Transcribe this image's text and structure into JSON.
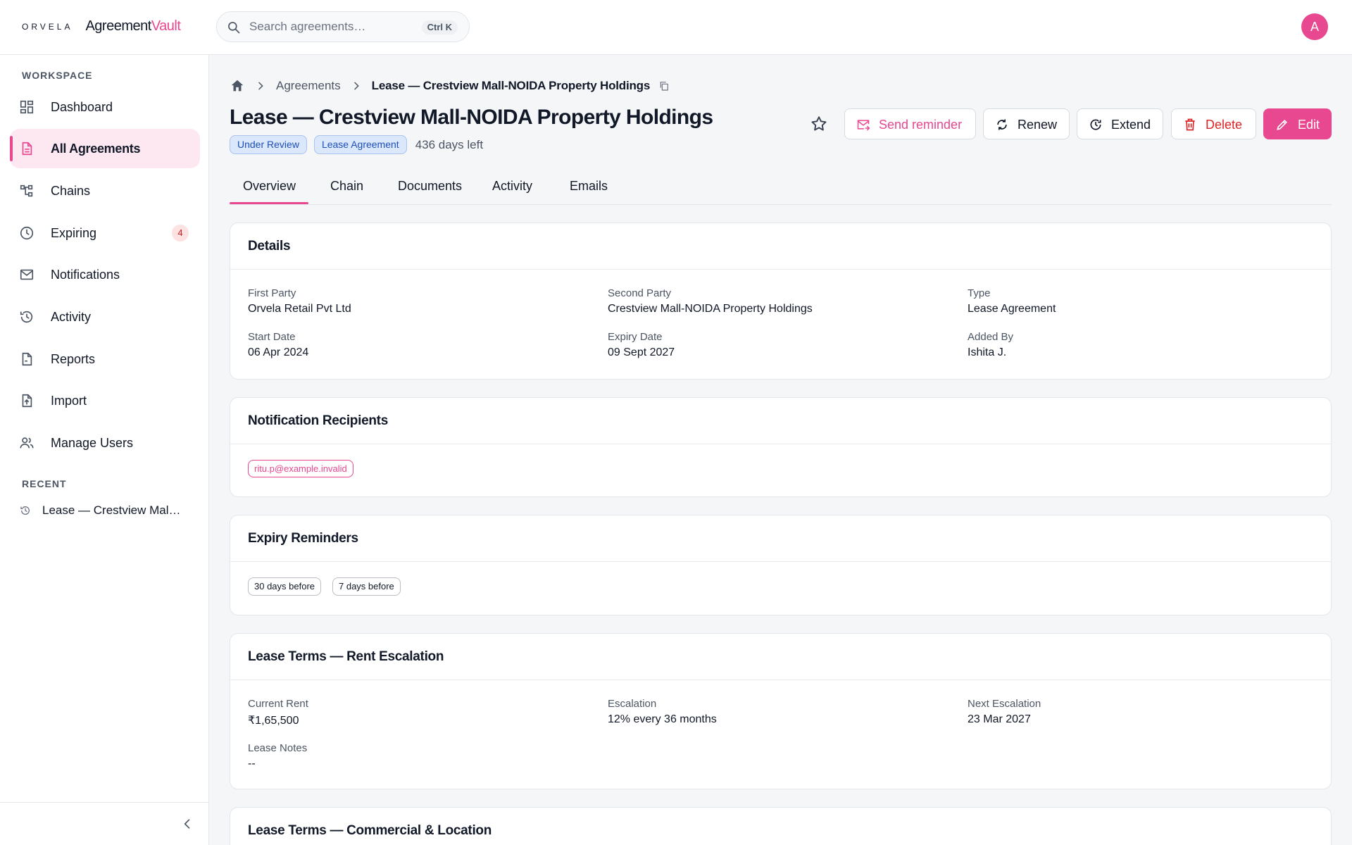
{
  "brand": {
    "company": "ORVELA",
    "product_a": "Agreement",
    "product_b": "Vault",
    "accent_color": "#e8488f"
  },
  "search": {
    "placeholder": "Search agreements…",
    "shortcut": "Ctrl K"
  },
  "user": {
    "avatar_initial": "A"
  },
  "sidebar": {
    "section_workspace": "WORKSPACE",
    "items": [
      {
        "label": "Dashboard",
        "icon": "dashboard-icon"
      },
      {
        "label": "All Agreements",
        "icon": "document-icon",
        "active": true
      },
      {
        "label": "Chains",
        "icon": "chain-icon"
      },
      {
        "label": "Expiring",
        "icon": "clock-icon",
        "badge": "4"
      },
      {
        "label": "Notifications",
        "icon": "mail-icon"
      },
      {
        "label": "Activity",
        "icon": "history-icon"
      },
      {
        "label": "Reports",
        "icon": "report-icon"
      },
      {
        "label": "Import",
        "icon": "upload-icon"
      },
      {
        "label": "Manage Users",
        "icon": "users-icon"
      }
    ],
    "section_recent": "RECENT",
    "recent": [
      {
        "label": "Lease — Crestview Mall-NOIDA Property Holdings"
      }
    ]
  },
  "breadcrumb": {
    "link": "Agreements",
    "current": "Lease — Crestview Mall-NOIDA Property Holdings"
  },
  "page": {
    "title": "Lease — Crestview Mall-NOIDA Property Holdings",
    "status_tag": "Under Review",
    "type_tag": "Lease Agreement",
    "days_left": "436 days left"
  },
  "actions": {
    "send_reminder": "Send reminder",
    "renew": "Renew",
    "extend": "Extend",
    "delete": "Delete",
    "edit": "Edit"
  },
  "tabs": [
    "Overview",
    "Chain",
    "Documents",
    "Activity",
    "Emails"
  ],
  "details": {
    "title": "Details",
    "first_party_label": "First Party",
    "first_party": "Orvela Retail Pvt Ltd",
    "second_party_label": "Second Party",
    "second_party": "Crestview Mall-NOIDA Property Holdings",
    "type_label": "Type",
    "type": "Lease Agreement",
    "start_date_label": "Start Date",
    "start_date": "06 Apr 2024",
    "expiry_date_label": "Expiry Date",
    "expiry_date": "09 Sept 2027",
    "added_by_label": "Added By",
    "added_by": "Ishita J."
  },
  "recipients": {
    "title": "Notification Recipients",
    "emails": [
      "ritu.p@example.invalid"
    ]
  },
  "reminders": {
    "title": "Expiry Reminders",
    "items": [
      "30 days before",
      "7 days before"
    ]
  },
  "rent": {
    "title": "Lease Terms — Rent Escalation",
    "current_rent_label": "Current Rent",
    "current_rent": "₹1,65,500",
    "escalation_label": "Escalation",
    "escalation": "12% every 36 months",
    "next_escalation_label": "Next Escalation",
    "next_escalation": "23 Mar 2027",
    "notes_label": "Lease Notes",
    "notes": "--"
  },
  "commercial": {
    "title": "Lease Terms — Commercial & Location"
  }
}
